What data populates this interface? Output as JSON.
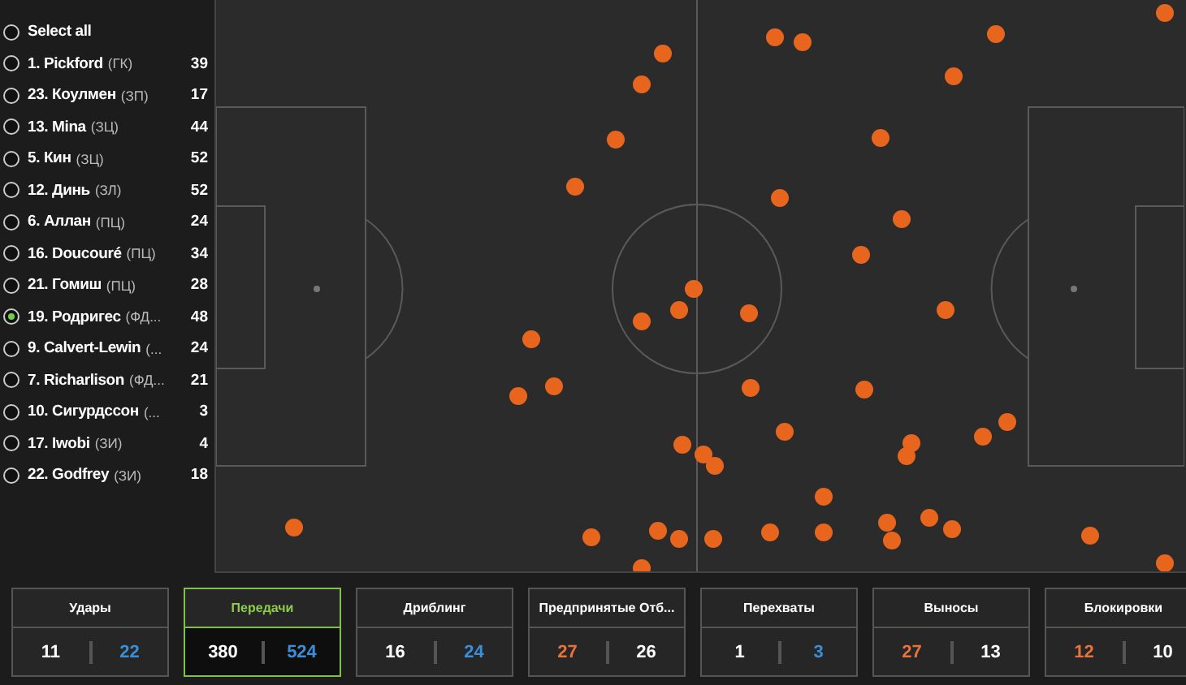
{
  "players": [
    {
      "name": "Select all",
      "selected": false
    },
    {
      "name": "1. Pickford",
      "position": "(ГК)",
      "count": "39",
      "selected": false
    },
    {
      "name": "23. Коулмен",
      "position": "(ЗП)",
      "count": "17",
      "selected": false
    },
    {
      "name": "13. Mina",
      "position": "(ЗЦ)",
      "count": "44",
      "selected": false
    },
    {
      "name": "5. Кин",
      "position": "(ЗЦ)",
      "count": "52",
      "selected": false
    },
    {
      "name": "12. Динь",
      "position": "(ЗЛ)",
      "count": "52",
      "selected": false
    },
    {
      "name": "6. Аллан",
      "position": "(ПЦ)",
      "count": "24",
      "selected": false
    },
    {
      "name": "16. Doucouré",
      "position": "(ПЦ)",
      "count": "34",
      "selected": false
    },
    {
      "name": "21. Гомиш",
      "position": "(ПЦ)",
      "count": "28",
      "selected": false
    },
    {
      "name": "19. Родригес",
      "position": "(ФД...",
      "count": "48",
      "selected": true
    },
    {
      "name": "9. Calvert-Lewin",
      "position": "(...",
      "count": "24",
      "selected": false
    },
    {
      "name": "7. Richarlison",
      "position": "(ФД...",
      "count": "21",
      "selected": false
    },
    {
      "name": "10. Сигурдссон",
      "position": "(...",
      "count": "3",
      "selected": false
    },
    {
      "name": "17. Iwobi",
      "position": "(ЗИ)",
      "count": "4",
      "selected": false
    },
    {
      "name": "22. Godfrey",
      "position": "(ЗИ)",
      "count": "18",
      "selected": false
    }
  ],
  "stats": [
    {
      "title": "Удары",
      "selected": false,
      "values": [
        {
          "text": "11",
          "color": "#ffffff"
        },
        {
          "text": "22",
          "color": "#3b8fd8"
        }
      ]
    },
    {
      "title": "Передачи",
      "selected": true,
      "values": [
        {
          "text": "380",
          "color": "#ffffff"
        },
        {
          "text": "524",
          "color": "#3b8fd8"
        }
      ]
    },
    {
      "title": "Дриблинг",
      "selected": false,
      "values": [
        {
          "text": "16",
          "color": "#ffffff"
        },
        {
          "text": "24",
          "color": "#3b8fd8"
        }
      ]
    },
    {
      "title": "Предпринятые Отб...",
      "selected": false,
      "values": [
        {
          "text": "27",
          "color": "#e8733a"
        },
        {
          "text": "26",
          "color": "#ffffff"
        }
      ]
    },
    {
      "title": "Перехваты",
      "selected": false,
      "values": [
        {
          "text": "1",
          "color": "#ffffff"
        },
        {
          "text": "3",
          "color": "#3b8fd8"
        }
      ]
    },
    {
      "title": "Выносы",
      "selected": false,
      "values": [
        {
          "text": "27",
          "color": "#e8733a"
        },
        {
          "text": "13",
          "color": "#ffffff"
        }
      ]
    },
    {
      "title": "Блокировки",
      "selected": false,
      "values": [
        {
          "text": "12",
          "color": "#e8733a"
        },
        {
          "text": "10",
          "color": "#ffffff"
        }
      ]
    }
  ]
}
